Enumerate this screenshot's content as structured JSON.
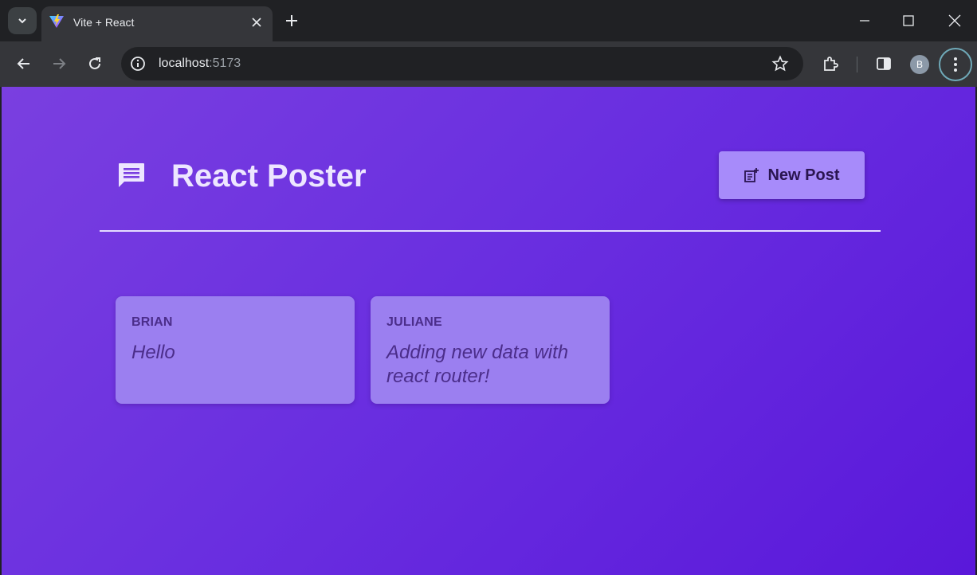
{
  "browser": {
    "tab_title": "Vite + React",
    "url_host": "localhost",
    "url_port": ":5173",
    "profile_initial": "B"
  },
  "app": {
    "title": "React Poster",
    "new_post_label": "New Post"
  },
  "posts": [
    {
      "author": "BRIAN",
      "body": "Hello"
    },
    {
      "author": "JULIANE",
      "body": "Adding new data with react router!"
    }
  ],
  "colors": {
    "accent": "#a78bfa",
    "card": "#9b7ff0",
    "background": "#6a2fe0"
  }
}
